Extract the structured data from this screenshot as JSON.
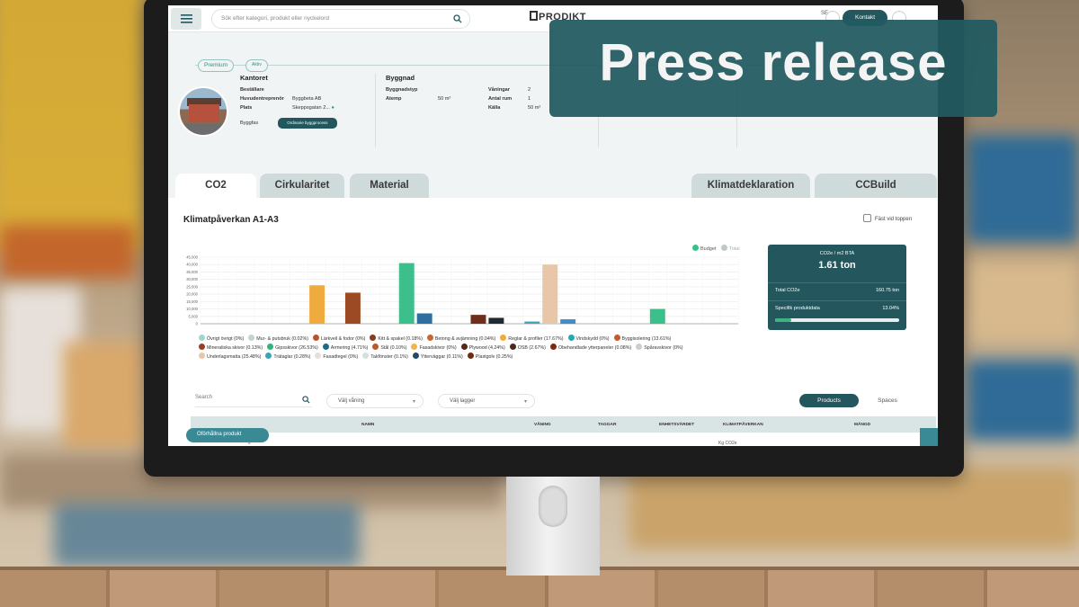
{
  "banner": {
    "text": "Press release"
  },
  "app": {
    "search_placeholder": "Sök efter kategori, produkt eller nyckelord",
    "logo_text": "PRODIKT",
    "language": "SE",
    "contact_label": "Kontakt"
  },
  "project": {
    "badges": [
      "Premium",
      "Aktiv"
    ],
    "office": {
      "title": "Kantoret",
      "fields": [
        {
          "label": "Beställare",
          "value": ""
        },
        {
          "label": "Huvudentreprenör",
          "value": "Byggbeta AB"
        },
        {
          "label": "Plats",
          "value": "Skeppsgatan 2..."
        }
      ],
      "buildphase_label": "Byggfas",
      "buildphase_button": "Ordinarie byggprocess"
    },
    "building": {
      "title": "Byggnad",
      "rows": [
        {
          "label": "Byggnadstyp",
          "value": "",
          "label2": "Våningar",
          "value2": "2"
        },
        {
          "label": "Atemp",
          "value": "50 m²",
          "label2": "Antal rum",
          "value2": "1"
        },
        {
          "label": "",
          "value": "",
          "label2": "Källa",
          "value2": "50 m²"
        }
      ]
    }
  },
  "tabs": [
    {
      "label": "CO2",
      "active": true
    },
    {
      "label": "Cirkularitet",
      "active": false
    },
    {
      "label": "Material",
      "active": false
    },
    {
      "label": "Klimatdeklaration",
      "active": false
    },
    {
      "label": "CCBuild",
      "active": false
    }
  ],
  "chart_section": {
    "title": "Klimatpåverkan A1-A3",
    "pin_label": "Fäst vid toppen",
    "legend": [
      {
        "name": "Budget",
        "color": "#3cbf8a"
      },
      {
        "name": "Total",
        "color": "#bfc9c9"
      }
    ]
  },
  "chart_data": {
    "type": "bar",
    "title": "Klimatpåverkan A1-A3",
    "ylim": [
      0,
      45000
    ],
    "yticks": [
      "45,000",
      "40,000",
      "35,000",
      "30,000",
      "25,000",
      "20,000",
      "15,000",
      "10,000",
      "5,000",
      "0"
    ],
    "grid": true,
    "legend_position": "top-right",
    "bars": [
      {
        "pos": 6,
        "value": 26000,
        "color": "#f0ab3f"
      },
      {
        "pos": 8,
        "value": 21000,
        "color": "#9c4a23"
      },
      {
        "pos": 11,
        "value": 41000,
        "color": "#3cbf8a"
      },
      {
        "pos": 12,
        "value": 7000,
        "color": "#2f6fa0"
      },
      {
        "pos": 15,
        "value": 6000,
        "color": "#6e2e19"
      },
      {
        "pos": 16,
        "value": 4000,
        "color": "#1f2a33"
      },
      {
        "pos": 18,
        "value": 1500,
        "color": "#4aa0bf"
      },
      {
        "pos": 19,
        "value": 40000,
        "color": "#e8c7a8"
      },
      {
        "pos": 20,
        "value": 3000,
        "color": "#3f8ec9"
      },
      {
        "pos": 25,
        "value": 10000,
        "color": "#3cbf8a"
      }
    ],
    "categories": [
      {
        "name": "Övrigt övrigt (0%)",
        "color": "#9fd6cf"
      },
      {
        "name": "Mur- & putsbruk (0.02%)",
        "color": "#c8d0d0"
      },
      {
        "name": "Lärkveil & fodor (0%)",
        "color": "#b4562e"
      },
      {
        "name": "Kitt & spakel (0.18%)",
        "color": "#8a3a1e"
      },
      {
        "name": "Betong & avjämning (0.04%)",
        "color": "#c9672d"
      },
      {
        "name": "Reglar & profiler (17.67%)",
        "color": "#f0ab3f"
      },
      {
        "name": "Vindskydd (0%)",
        "color": "#2aa6b3"
      },
      {
        "name": "Byggisolering (13.61%)",
        "color": "#c35b2a"
      },
      {
        "name": "Mineraliska skivor (0.13%)",
        "color": "#9c3d21"
      },
      {
        "name": "Gipsskivor (26.53%)",
        "color": "#2fb57b"
      },
      {
        "name": "Armering (4.71%)",
        "color": "#1b6b8a"
      },
      {
        "name": "Stål (0.10%)",
        "color": "#b85a2a"
      },
      {
        "name": "Fasadskivor (0%)",
        "color": "#f3b44b"
      },
      {
        "name": "Plywood (4.24%)",
        "color": "#5a2512"
      },
      {
        "name": "OSB (2.67%)",
        "color": "#4b2a1a"
      },
      {
        "name": "Obehandlade ytterpaneler (0.08%)",
        "color": "#7a2b13"
      },
      {
        "name": "Spåravskivor (0%)",
        "color": "#c7cfcf"
      },
      {
        "name": "Underlagsmatta (25.48%)",
        "color": "#e8c7a8"
      },
      {
        "name": "Trätaglar (0.28%)",
        "color": "#3aa5b8"
      },
      {
        "name": "Fasadtegel (0%)",
        "color": "#e3e0d6"
      },
      {
        "name": "Takfönster (0.1%)",
        "color": "#d6dede"
      },
      {
        "name": "Ytterväggar (0.11%)",
        "color": "#1e4d6b"
      },
      {
        "name": "Plastgolv (0.25%)",
        "color": "#6b2d12"
      }
    ]
  },
  "stat_card": {
    "label": "CO2e / m2 BTA",
    "value": "1.61 ton",
    "rows": [
      {
        "label": "Total CO2e",
        "value": "160.75 ton"
      },
      {
        "label": "Specifik produktdata",
        "value": "13.04%"
      }
    ],
    "progress": 0.1304
  },
  "filters": {
    "search_placeholder": "Search",
    "floor_select": "Välj våning",
    "layer_select": "Välj lagger",
    "products_label": "Products",
    "spaces_label": "Spaces"
  },
  "table": {
    "headers": [
      "NAMN",
      "VÅNING",
      "TAGGAR",
      "ENHETSVÄRDET",
      "KLIMATPÅVERKAN",
      "MÄNGD"
    ],
    "first_row": "Okända Budget",
    "first_row_extra": "Kg CO2e",
    "fab_label": "Oförhållna produkt"
  }
}
